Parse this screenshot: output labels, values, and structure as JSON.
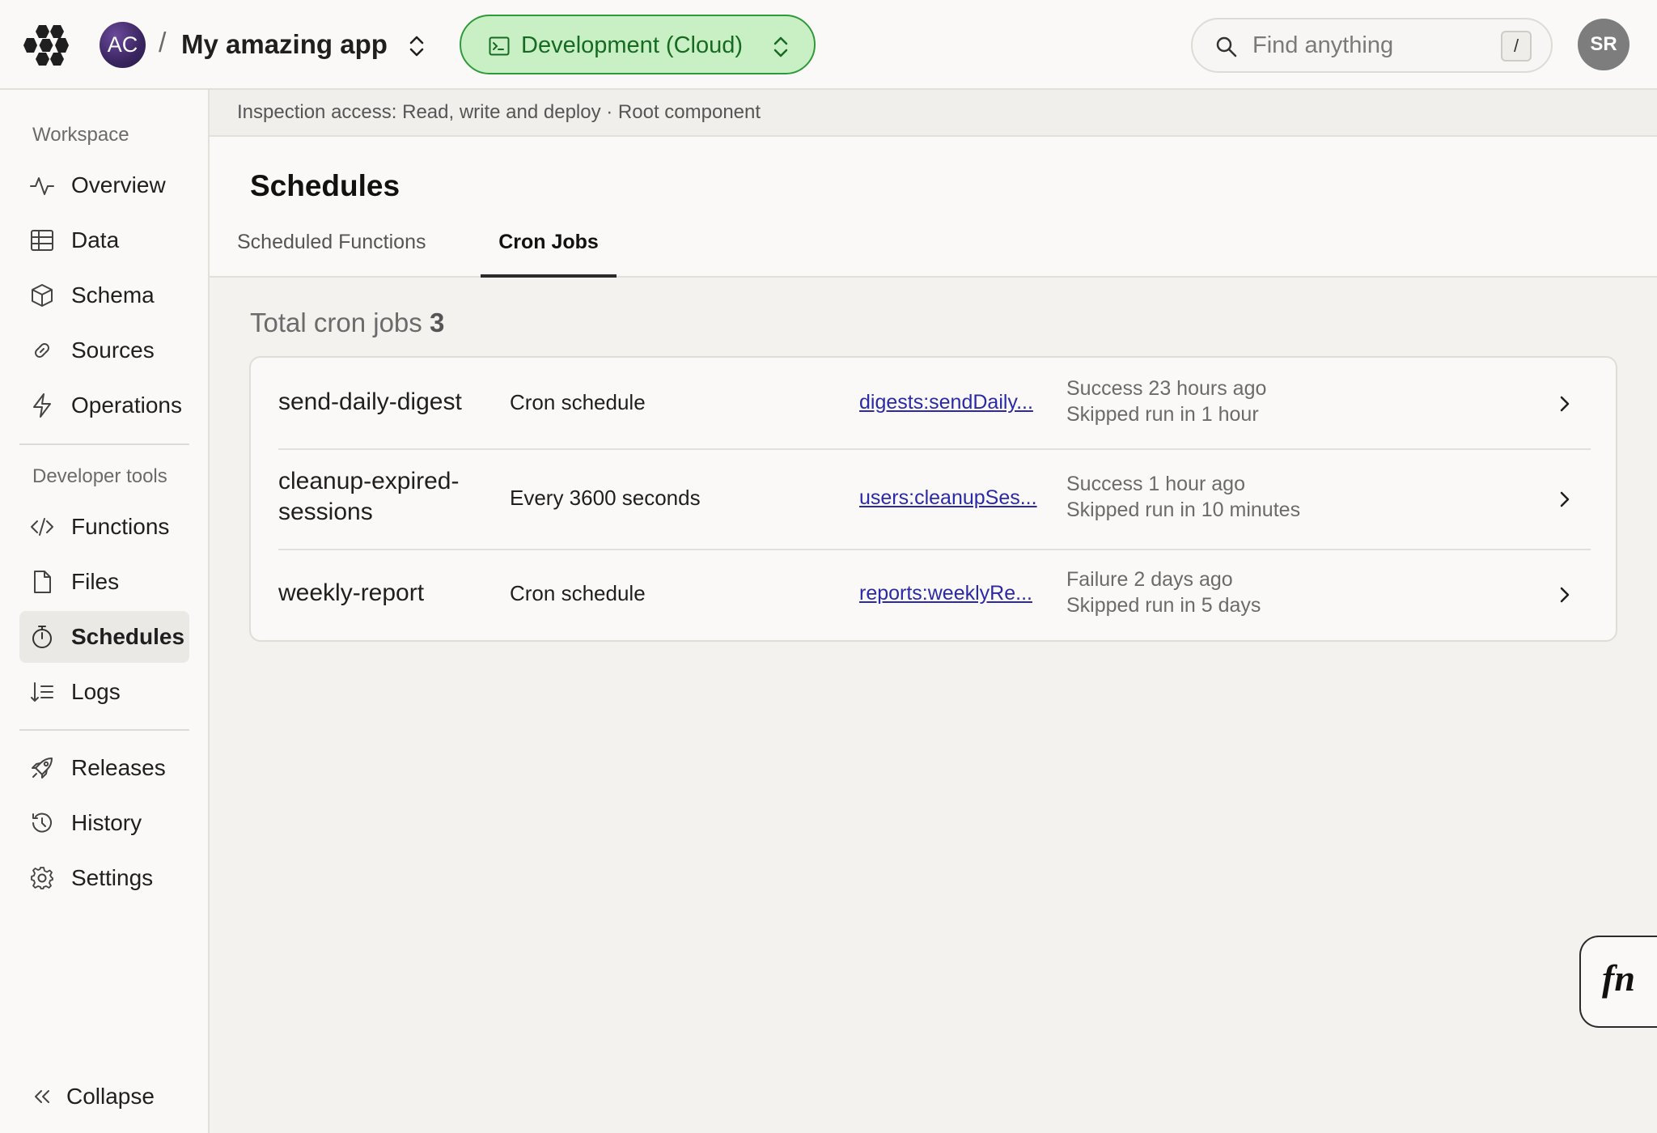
{
  "header": {
    "org_initials": "AC",
    "crumb_separator": "/",
    "project_name": "My amazing app",
    "deployment_label": "Development (Cloud)",
    "deployment_color": "#c9efc4",
    "search_placeholder": "Find anything",
    "search_shortcut": "/",
    "user_initials": "SR"
  },
  "sidebar": {
    "workspace_label": "Workspace",
    "workspace_items": [
      {
        "label": "Overview",
        "icon": "pulse-icon"
      },
      {
        "label": "Data",
        "icon": "table-icon"
      },
      {
        "label": "Schema",
        "icon": "cube-icon"
      },
      {
        "label": "Sources",
        "icon": "link-icon"
      },
      {
        "label": "Operations",
        "icon": "lightning-icon"
      }
    ],
    "devtools_label": "Developer tools",
    "devtools_items": [
      {
        "label": "Functions",
        "icon": "code-icon"
      },
      {
        "label": "Files",
        "icon": "file-icon"
      },
      {
        "label": "Schedules",
        "icon": "stopwatch-icon",
        "active": true
      },
      {
        "label": "Logs",
        "icon": "list-sort-icon"
      }
    ],
    "bottom_items": [
      {
        "label": "Releases",
        "icon": "rocket-icon"
      },
      {
        "label": "History",
        "icon": "history-icon"
      },
      {
        "label": "Settings",
        "icon": "gear-icon"
      }
    ],
    "collapse_label": "Collapse"
  },
  "info_bar": {
    "text": "Inspection access: Read, write and deploy · Root component"
  },
  "page": {
    "title": "Schedules",
    "tabs": [
      {
        "label": "Scheduled Functions",
        "active": false
      },
      {
        "label": "Cron Jobs",
        "active": true
      }
    ],
    "total_label": "Total cron jobs",
    "total_count": "3"
  },
  "cron_jobs": [
    {
      "name": "send-daily-digest",
      "schedule": "Cron schedule",
      "function": "digests:sendDaily...",
      "last_run": "Success 23 hours ago",
      "next_run": "Skipped run in 1 hour"
    },
    {
      "name": "cleanup-expired-sessions",
      "schedule": "Every 3600 seconds",
      "function": "users:cleanupSes...",
      "last_run": "Success 1 hour ago",
      "next_run": "Skipped run in 10 minutes"
    },
    {
      "name": "weekly-report",
      "schedule": "Cron schedule",
      "function": "reports:weeklyRe...",
      "last_run": "Failure 2 days ago",
      "next_run": "Skipped run in 5 days"
    }
  ],
  "fn_button_label": "fn"
}
